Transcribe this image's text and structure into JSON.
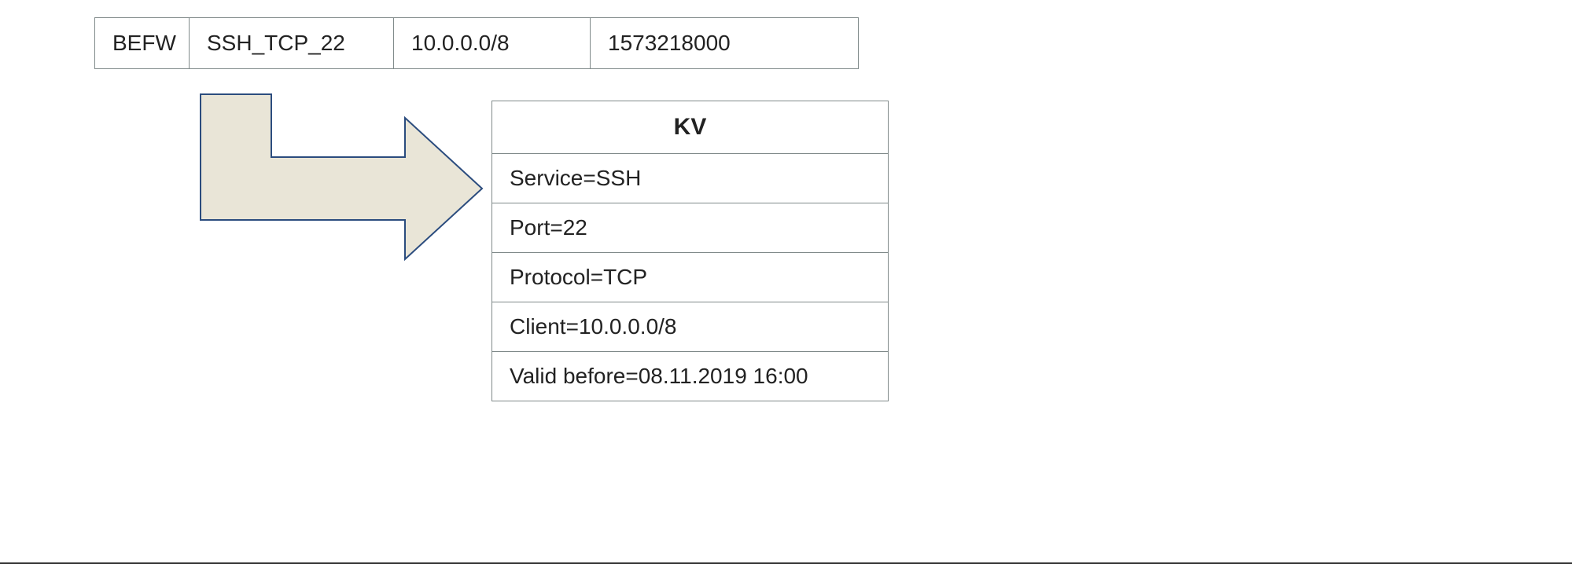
{
  "top_row": {
    "col1": "BEFW",
    "col2": "SSH_TCP_22",
    "col3": "10.0.0.0/8",
    "col4": "1573218000"
  },
  "arrow": {
    "fill": "#e9e5d7",
    "stroke": "#2b4c7e"
  },
  "kv": {
    "title": "KV",
    "rows": [
      "Service=SSH",
      "Port=22",
      "Protocol=TCP",
      "Client=10.0.0.0/8",
      "Valid before=08.11.2019 16:00"
    ]
  }
}
